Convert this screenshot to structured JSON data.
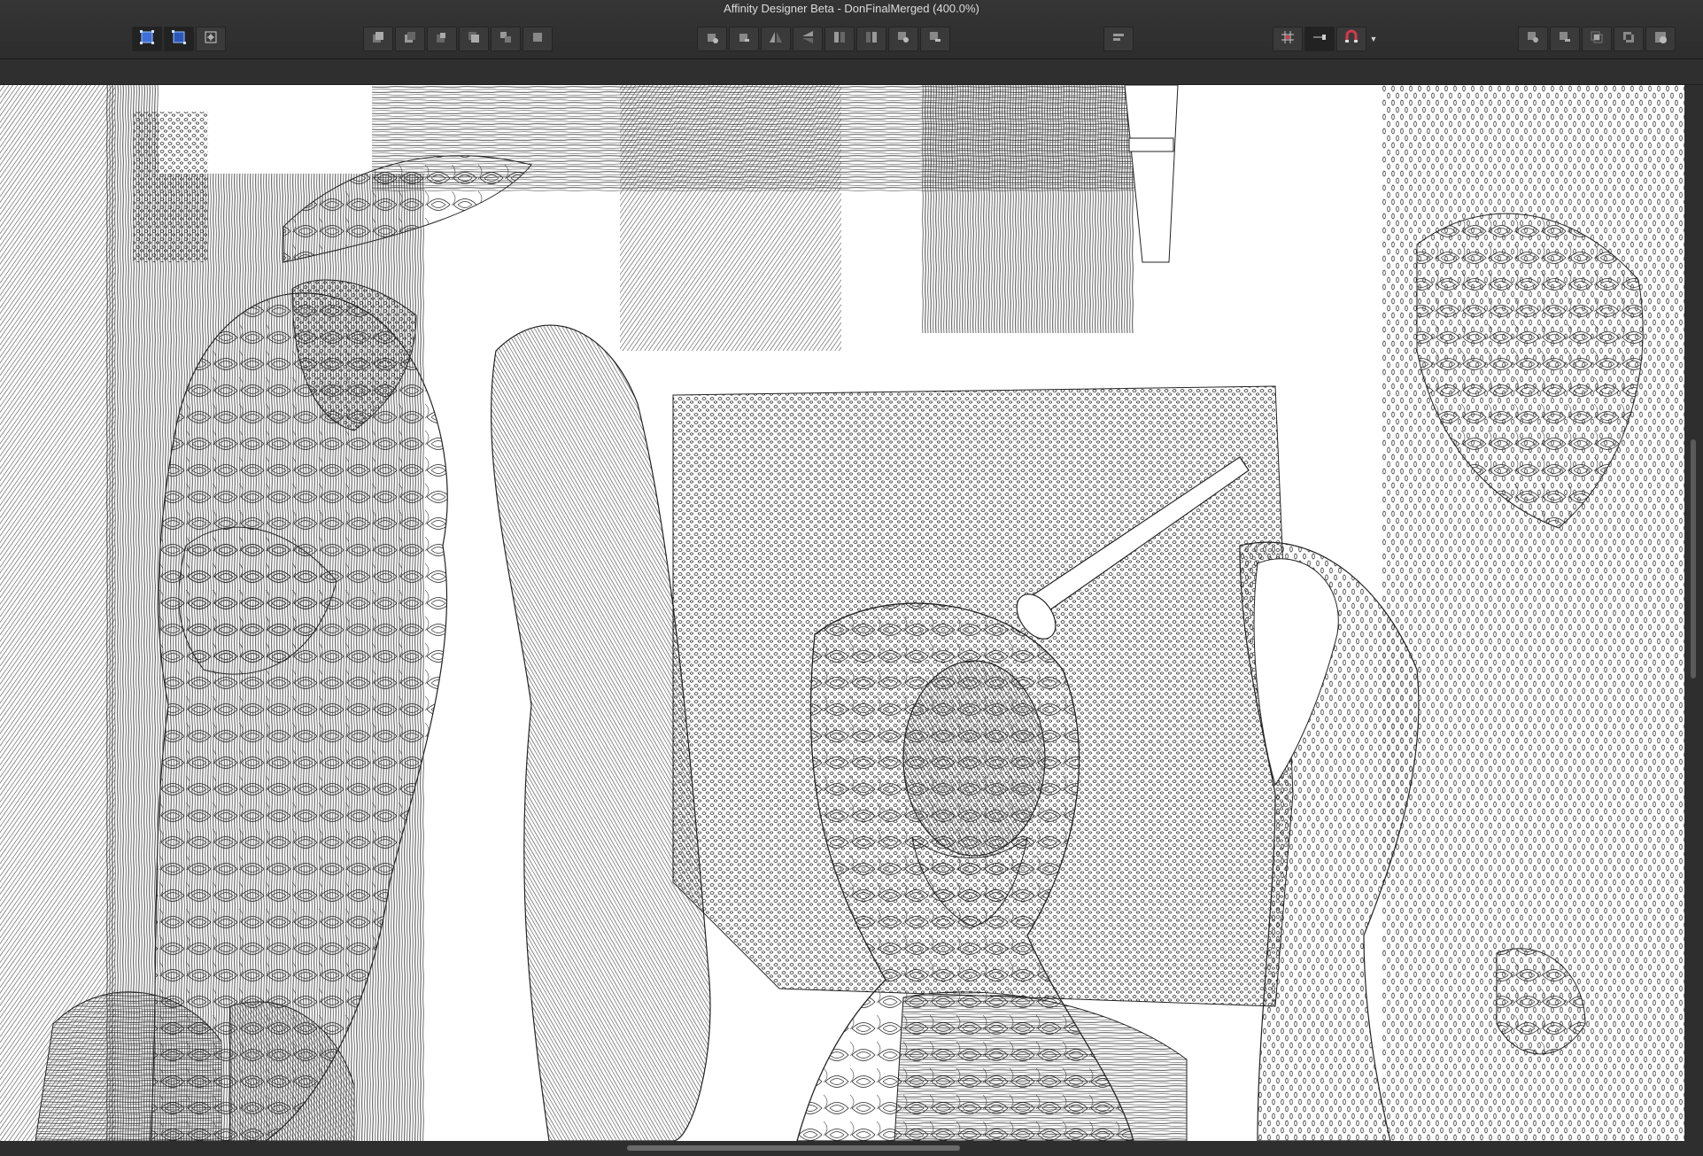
{
  "window": {
    "title": "Affinity Designer Beta - DonFinalMerged (400.0%)"
  },
  "toolbar": {
    "selection_group": [
      {
        "icon": "select-bounding-icon",
        "active": true
      },
      {
        "icon": "select-geometry-icon",
        "active": true
      },
      {
        "icon": "transform-origin-icon",
        "active": false
      }
    ],
    "arrange_group": [
      {
        "icon": "move-to-back-icon"
      },
      {
        "icon": "move-back-one-icon"
      },
      {
        "icon": "move-forward-one-icon"
      },
      {
        "icon": "move-to-front-icon"
      },
      {
        "icon": "group-icon"
      },
      {
        "icon": "ungroup-icon"
      }
    ],
    "transform_group": [
      {
        "icon": "rotate-left-icon"
      },
      {
        "icon": "rotate-right-icon"
      },
      {
        "icon": "flip-horizontal-icon"
      },
      {
        "icon": "flip-vertical-icon"
      },
      {
        "icon": "align-left-icon"
      },
      {
        "icon": "align-right-icon"
      },
      {
        "icon": "boolean-add-icon"
      },
      {
        "icon": "boolean-subtract-icon"
      }
    ],
    "align_group": [
      {
        "icon": "alignment-icon"
      }
    ],
    "snapping_group": [
      {
        "icon": "grid-icon"
      },
      {
        "icon": "snap-to-icon",
        "active": true
      },
      {
        "icon": "snapping-magnet-icon"
      }
    ],
    "boolean_group": [
      {
        "icon": "boolean-add-icon"
      },
      {
        "icon": "boolean-subtract-icon"
      },
      {
        "icon": "boolean-intersect-icon"
      },
      {
        "icon": "boolean-xor-icon"
      },
      {
        "icon": "boolean-divide-icon"
      }
    ]
  },
  "colors": {
    "chrome": "#2e2e2e",
    "canvas": "#ffffff",
    "magnet_accent": "#d23a4b"
  }
}
